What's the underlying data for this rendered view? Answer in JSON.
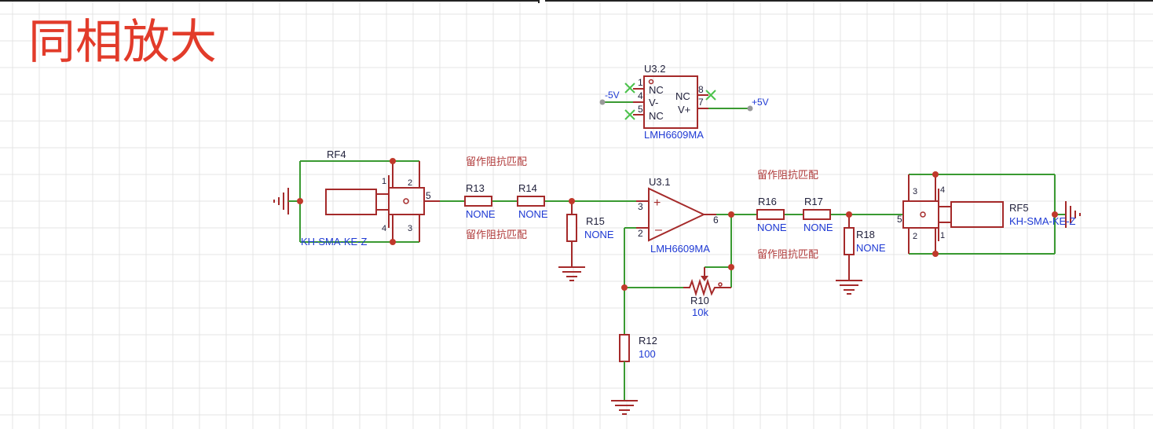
{
  "title": "同相放大",
  "colors": {
    "wire": "#3a9a32",
    "component": "#a52a2a",
    "dot": "#c0392b",
    "label_dark": "#1f1f3a",
    "label_blue": "#1f3ad4",
    "label_red": "#b03a3a",
    "title": "#e23b2a",
    "grid": "#e4e4e4",
    "nc_mark": "#4cc24c"
  },
  "u32": {
    "ref": "U3.2",
    "value": "LMH6609MA",
    "pins_left": [
      {
        "num": "1",
        "name": "NC"
      },
      {
        "num": "4",
        "name": "V-"
      },
      {
        "num": "5",
        "name": "NC"
      }
    ],
    "pins_right": [
      {
        "num": "8",
        "name": "NC"
      },
      {
        "num": "7",
        "name": "V+"
      }
    ],
    "net_neg": "-5V",
    "net_pos": "+5V"
  },
  "rf4": {
    "ref": "RF4",
    "value": "KH-SMA-KE-Z",
    "pins": [
      "1",
      "2",
      "4",
      "3",
      "5"
    ]
  },
  "rf5": {
    "ref": "RF5",
    "value": "KH-SMA-KE-Z",
    "pins": [
      "3",
      "4",
      "2",
      "1",
      "5"
    ]
  },
  "notes": {
    "note1": "留作阻抗匹配",
    "note2": "留作阻抗匹配",
    "note3": "留作阻抗匹配",
    "note4": "留作阻抗匹配"
  },
  "r13": {
    "ref": "R13",
    "value": "NONE"
  },
  "r14": {
    "ref": "R14",
    "value": "NONE"
  },
  "r15": {
    "ref": "R15",
    "value": "NONE"
  },
  "r16": {
    "ref": "R16",
    "value": "NONE"
  },
  "r17": {
    "ref": "R17",
    "value": "NONE"
  },
  "r18": {
    "ref": "R18",
    "value": "NONE"
  },
  "r10": {
    "ref": "R10",
    "value": "10k"
  },
  "r12": {
    "ref": "R12",
    "value": "100"
  },
  "u31": {
    "ref": "U3.1",
    "value": "LMH6609MA",
    "pin_plus": "3",
    "pin_minus": "2",
    "pin_out": "6"
  }
}
